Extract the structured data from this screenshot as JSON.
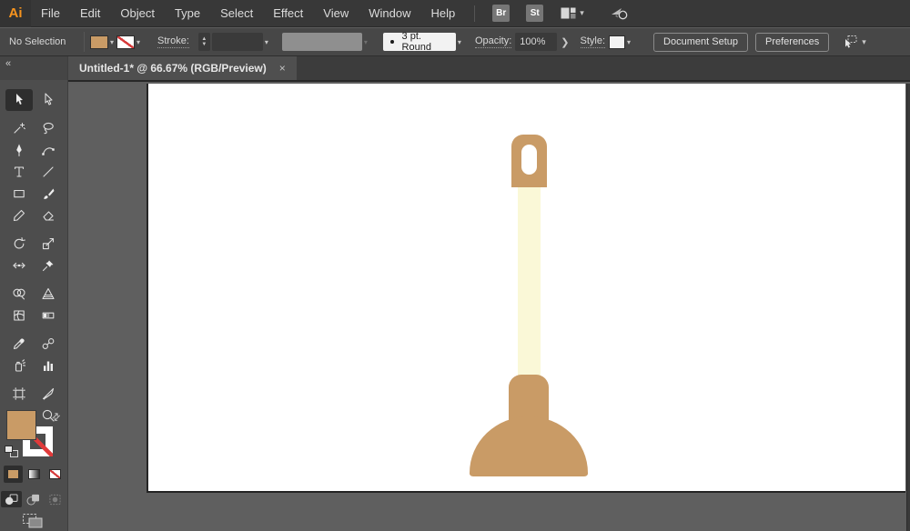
{
  "app": {
    "logo": "Ai"
  },
  "menubar": {
    "items": [
      "File",
      "Edit",
      "Object",
      "Type",
      "Select",
      "Effect",
      "View",
      "Window",
      "Help"
    ],
    "bridge_label": "Br",
    "stock_label": "St"
  },
  "controlbar": {
    "selection_status": "No Selection",
    "fill_color": "#C99B66",
    "stroke_swatch": "none",
    "stroke_label": "Stroke:",
    "brush_value": "3 pt. Round",
    "opacity_label": "Opacity:",
    "opacity_value": "100%",
    "style_label": "Style:",
    "document_setup_label": "Document Setup",
    "preferences_label": "Preferences"
  },
  "tabbar": {
    "tabs": [
      {
        "title": "Untitled-1* @ 66.67% (RGB/Preview)",
        "close_glyph": "×",
        "active": true
      }
    ]
  },
  "toolbar": {
    "collapse_glyph": "«",
    "fill_color": "#C99B66",
    "groups": [
      [
        {
          "name": "selection",
          "selected": true
        },
        {
          "name": "direct-selection"
        }
      ],
      [
        {
          "name": "magic-wand"
        },
        {
          "name": "lasso"
        },
        {
          "name": "pen"
        },
        {
          "name": "curvature"
        },
        {
          "name": "type"
        },
        {
          "name": "line-segment"
        },
        {
          "name": "rectangle"
        },
        {
          "name": "paintbrush"
        },
        {
          "name": "shaper"
        },
        {
          "name": "eraser"
        }
      ],
      [
        {
          "name": "rotate"
        },
        {
          "name": "scale"
        },
        {
          "name": "width"
        },
        {
          "name": "puppet-warp"
        }
      ],
      [
        {
          "name": "shape-builder"
        },
        {
          "name": "perspective-grid"
        },
        {
          "name": "mesh"
        },
        {
          "name": "gradient"
        }
      ],
      [
        {
          "name": "eyedropper"
        },
        {
          "name": "blend"
        },
        {
          "name": "symbol-sprayer"
        },
        {
          "name": "column-graph"
        }
      ],
      [
        {
          "name": "artboard"
        },
        {
          "name": "slice"
        },
        {
          "name": "hand"
        },
        {
          "name": "zoom"
        }
      ]
    ]
  },
  "canvas": {
    "artboard_color": "#FFFFFF",
    "pasteboard_color": "#5F5F5F",
    "artwork": {
      "name": "plunger-illustration",
      "handle_color": "#C99B66",
      "shaft_color": "#FAF8D7",
      "cup_color": "#C99B66"
    }
  }
}
